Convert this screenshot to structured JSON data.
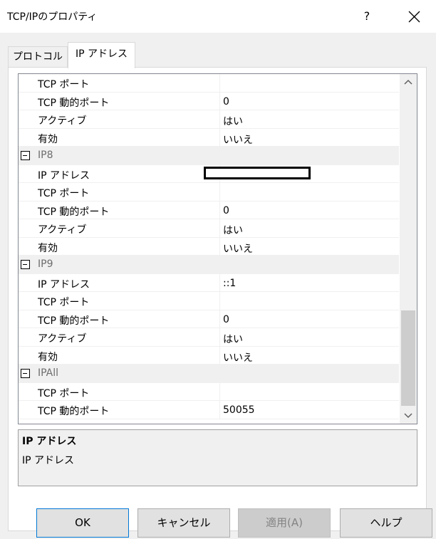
{
  "window": {
    "title": "TCP/IPのプロパティ",
    "help_glyph": "?"
  },
  "tabs": [
    {
      "label": "プロトコル"
    },
    {
      "label": "IP アドレス"
    }
  ],
  "rows": [
    {
      "type": "prop",
      "name": "TCP ポート",
      "value": ""
    },
    {
      "type": "prop",
      "name": "TCP 動的ポート",
      "value": "0"
    },
    {
      "type": "prop",
      "name": "アクティブ",
      "value": "はい"
    },
    {
      "type": "prop",
      "name": "有効",
      "value": "いいえ"
    },
    {
      "type": "cat",
      "name": "IP8"
    },
    {
      "type": "prop",
      "name": "IP アドレス",
      "value": "",
      "redacted": true
    },
    {
      "type": "prop",
      "name": "TCP ポート",
      "value": ""
    },
    {
      "type": "prop",
      "name": "TCP 動的ポート",
      "value": "0"
    },
    {
      "type": "prop",
      "name": "アクティブ",
      "value": "はい"
    },
    {
      "type": "prop",
      "name": "有効",
      "value": "いいえ"
    },
    {
      "type": "cat",
      "name": "IP9"
    },
    {
      "type": "prop",
      "name": "IP アドレス",
      "value": "::1"
    },
    {
      "type": "prop",
      "name": "TCP ポート",
      "value": ""
    },
    {
      "type": "prop",
      "name": "TCP 動的ポート",
      "value": "0"
    },
    {
      "type": "prop",
      "name": "アクティブ",
      "value": "はい"
    },
    {
      "type": "prop",
      "name": "有効",
      "value": "いいえ"
    },
    {
      "type": "cat",
      "name": "IPAll"
    },
    {
      "type": "prop",
      "name": "TCP ポート",
      "value": ""
    },
    {
      "type": "prop",
      "name": "TCP 動的ポート",
      "value": "50055"
    }
  ],
  "description": {
    "title": "IP アドレス",
    "text": "IP アドレス"
  },
  "buttons": {
    "ok": "OK",
    "cancel": "キャンセル",
    "apply": "適用(A)",
    "help": "ヘルプ"
  },
  "colors": {
    "accent": "#0078d7",
    "category_bg": "#f0f0f0",
    "disabled_text": "#838383"
  }
}
